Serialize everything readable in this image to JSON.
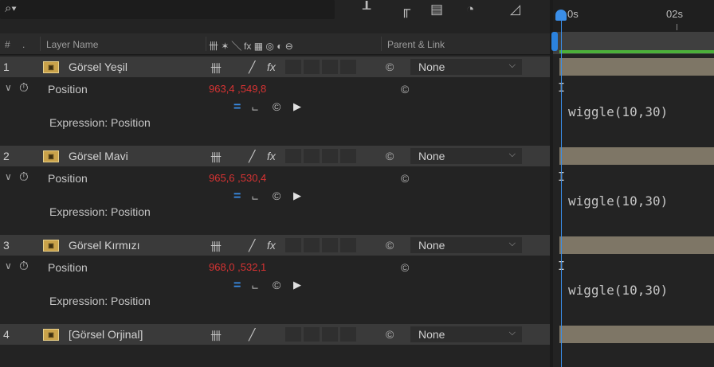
{
  "toolbar": {
    "search_icon": "search-icon",
    "icons": [
      "flowchart-icon",
      "draft-3d-icon",
      "frame-blending-icon",
      "motion-blur-icon",
      "graph-editor-icon"
    ]
  },
  "columns": {
    "hash": "#",
    "label_col": "",
    "layer_name": "Layer Name",
    "switches": "卌 ✶ ╲ fx ▦ ◎ ◐ ⊖",
    "parent_link": "Parent & Link"
  },
  "layers": [
    {
      "num": "1",
      "name": "Görsel Yeşil",
      "parent": "None",
      "property": "Position",
      "value": "963,4 ,549,8",
      "expression_label": "Expression: Position",
      "expression": "wiggle(10,30)"
    },
    {
      "num": "2",
      "name": "Görsel Mavi",
      "parent": "None",
      "property": "Position",
      "value": "965,6 ,530,4",
      "expression_label": "Expression: Position",
      "expression": "wiggle(10,30)"
    },
    {
      "num": "3",
      "name": "Görsel Kırmızı",
      "parent": "None",
      "property": "Position",
      "value": "968,0 ,532,1",
      "expression_label": "Expression: Position",
      "expression": "wiggle(10,30)"
    }
  ],
  "layer4": {
    "num": "4",
    "name": "[Görsel Orjinal]",
    "parent": "None"
  },
  "timeline": {
    "ruler_start": "0s",
    "ruler_02": "02s"
  },
  "colors": {
    "value_red": "#d83333",
    "cti_blue": "#3a8ee8",
    "workarea_green": "#4caf3a",
    "layer_bar": "#7e7666"
  }
}
